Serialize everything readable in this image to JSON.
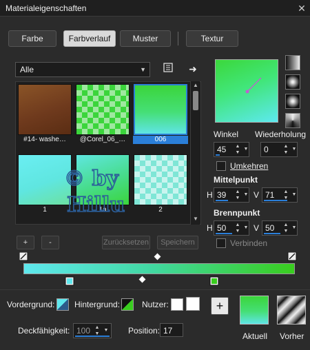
{
  "window": {
    "title": "Materialeigenschaften",
    "close": "✕"
  },
  "tabs": [
    {
      "label": "Farbe"
    },
    {
      "label": "Farbverlauf",
      "active": true
    },
    {
      "label": "Muster"
    },
    {
      "label": "Textur"
    }
  ],
  "library": {
    "dropdown_value": "Alle",
    "items": [
      {
        "caption": "#14- washe…",
        "style": "brown"
      },
      {
        "caption": "@Corel_06_…",
        "style": "checker-green"
      },
      {
        "caption": "006",
        "style": "green-cyan",
        "selected": true
      },
      {
        "caption": "1",
        "style": "cyan-green"
      },
      {
        "caption": "1a",
        "style": "green-cyan-2"
      },
      {
        "caption": "2",
        "style": "checker-cyan"
      }
    ],
    "watermark": "© by Hillu"
  },
  "actions": {
    "add": "+",
    "remove": "-",
    "reset": "Zurücksetzen",
    "save": "Speichern"
  },
  "gradient": {
    "angle_label": "Winkel",
    "angle_value": "45",
    "repeat_label": "Wiederholung",
    "repeat_value": "0",
    "reverse_label": "Umkehren",
    "midpoint_label": "Mittelpunkt",
    "mid_h_label": "H",
    "mid_h_value": "39",
    "mid_v_label": "V",
    "mid_v_value": "71",
    "focus_label": "Brennpunkt",
    "focus_h_label": "H",
    "focus_h_value": "50",
    "focus_v_label": "V",
    "focus_v_value": "50",
    "link_label": "Verbinden"
  },
  "bottom": {
    "foreground_label": "Vordergrund:",
    "background_label": "Hintergrund:",
    "user_label": "Nutzer:",
    "opacity_label": "Deckfähigkeit:",
    "opacity_value": "100",
    "position_label": "Position:",
    "position_value": "17",
    "current_label": "Aktuell",
    "previous_label": "Vorher",
    "add_symbol": "+"
  },
  "colors": {
    "accent": "#2b7fd9",
    "green": "#39cd1e",
    "cyan": "#5fe8ee",
    "panel": "#2b2b2b"
  }
}
